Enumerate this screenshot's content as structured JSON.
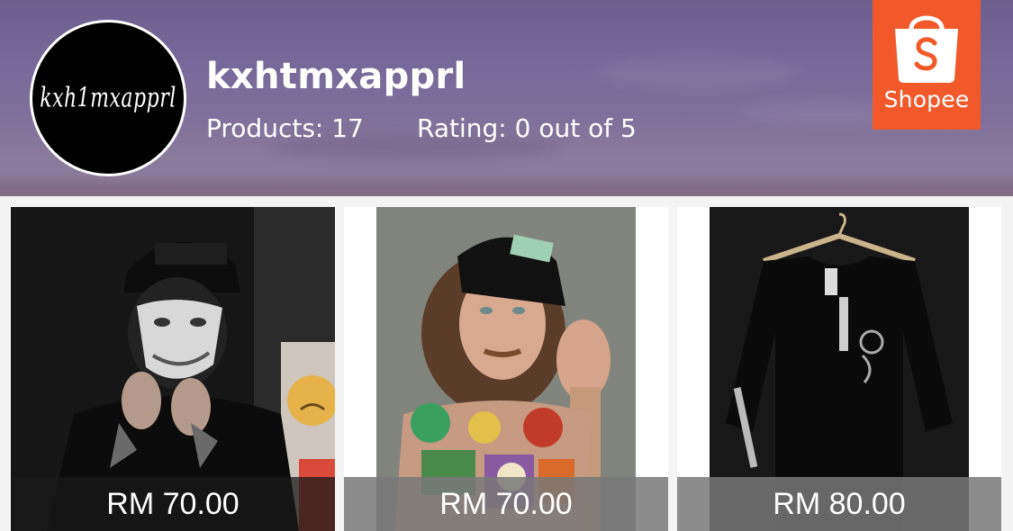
{
  "shop": {
    "name": "kxhtmxapprl",
    "avatar_text": "kxh1mxapprl",
    "products_label": "Products: 17",
    "rating_label": "Rating: 0 out of 5"
  },
  "brand": {
    "logo_text": "Shopee",
    "logo_color": "#f1592a",
    "icon": "shopping-bag-icon"
  },
  "products": [
    {
      "price": "RM 70.00",
      "image": "masked-man-in-cap-photo"
    },
    {
      "price": "RM 70.00",
      "image": "tattooed-man-in-cap-photo"
    },
    {
      "price": "RM 80.00",
      "image": "black-longsleeve-shirt-on-hanger-photo"
    }
  ]
}
